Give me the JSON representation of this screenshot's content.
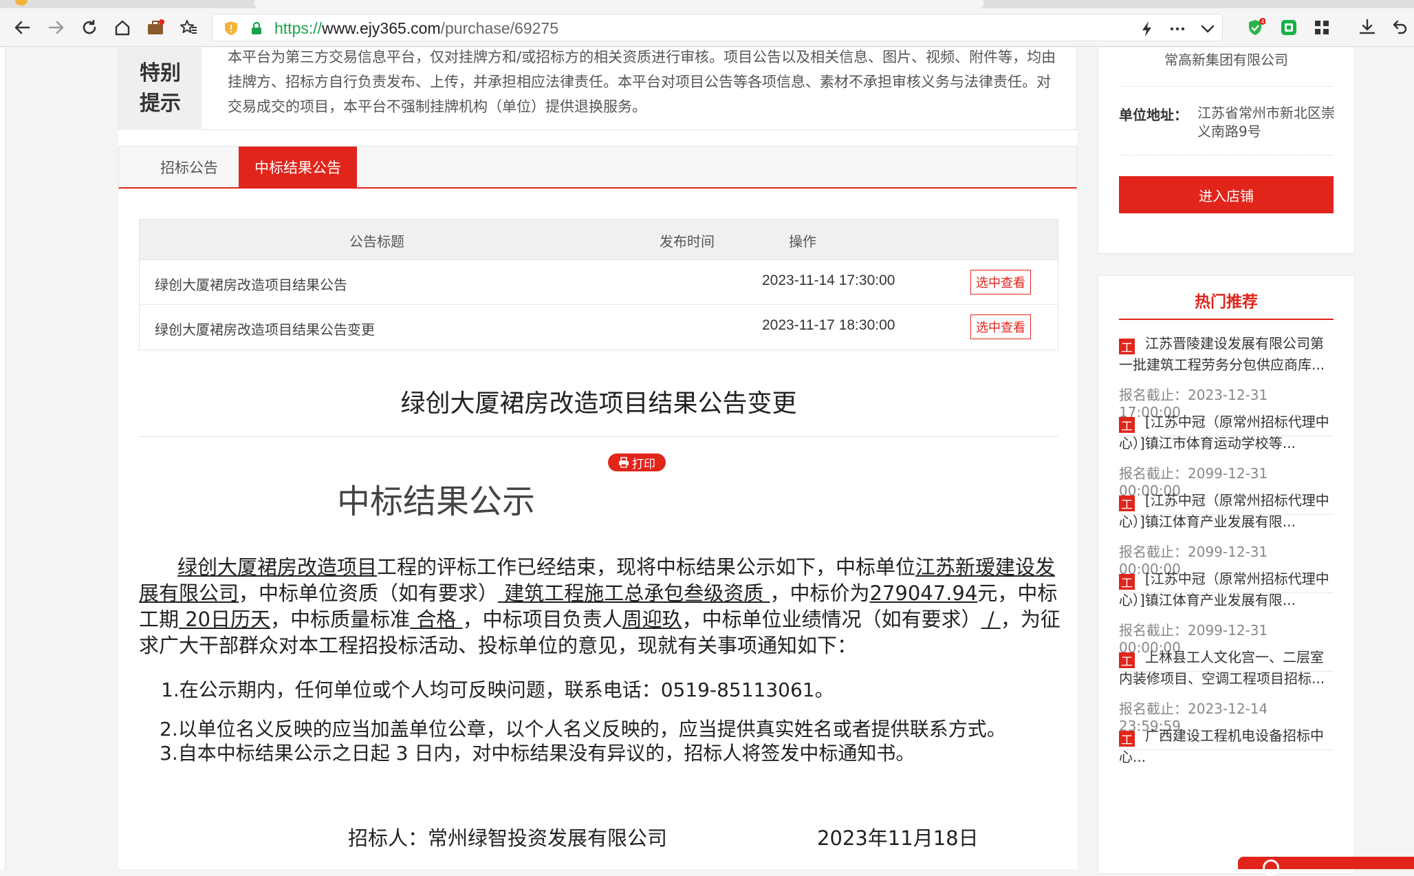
{
  "browser": {
    "url_protocol": "https://",
    "url_host": "www.ejy365.com",
    "url_path": "/purchase/69275",
    "badge_count": "4"
  },
  "notice": {
    "label_line1": "特别",
    "label_line2": "提示",
    "text": "本平台为第三方交易信息平台，仅对挂牌方和/或招标方的相关资质进行审核。项目公告以及相关信息、图片、视频、附件等，均由挂牌方、招标方自行负责发布、上传，并承担相应法律责任。本平台对项目公告等各项信息、素材不承担审核义务与法律责任。对交易成交的项目，本平台不强制挂牌机构（单位）提供退换服务。"
  },
  "tabs": [
    {
      "label": "招标公告",
      "active": false
    },
    {
      "label": "中标结果公告",
      "active": true
    }
  ],
  "table": {
    "headers": [
      "公告标题",
      "发布时间",
      "操作"
    ],
    "rows": [
      {
        "title": "绿创大厦裙房改造项目结果公告",
        "time": "2023-11-14 17:30:00",
        "action": "选中查看"
      },
      {
        "title": "绿创大厦裙房改造项目结果公告变更",
        "time": "2023-11-17 18:30:00",
        "action": "选中查看"
      }
    ]
  },
  "article": {
    "title": "绿创大厦裙房改造项目结果公告变更",
    "print_label": "打印",
    "doc_heading": "中标结果公示",
    "para": {
      "project": "绿创大厦裙房改造项目",
      "t1": "工程的评标工作已经结束，现将中标结果公示如下，中标单位",
      "winner": "江苏新瑷建设发展有限公司",
      "t2": "，中标单位资质（如有要求）",
      "qualification": " 建筑工程施工总承包叁级资质 ",
      "t3": "，中标价为",
      "price": "279047.94",
      "t4": "元，中标工期",
      "period": " 20日历天",
      "t5": "，中标质量标准",
      "quality": " 合格 ",
      "t6": "，中标项目负责人",
      "manager": "周迎玖",
      "t7": "，中标单位业绩情况（如有要求）",
      "record": " / ",
      "t8": "，为征求广大干部群众对本工程招投标活动、投标单位的意见，现就有关事项通知如下："
    },
    "items": [
      "1.在公示期内，任何单位或个人均可反映问题，联系电话：0519-85113061。",
      "2.以单位名义反映的应当加盖单位公章，以个人名义反映的，应当提供真实姓名或者提供联系方式。",
      "3.自本中标结果公示之日起 3 日内，对中标结果没有异议的，招标人将签发中标通知书。"
    ],
    "signer": "招标人：常州绿智投资发展有限公司",
    "sign_date": "2023年11月18日"
  },
  "sidebar": {
    "company": "常高新集团有限公司",
    "address_label": "单位地址：",
    "address_value": "江苏省常州市新北区崇义南路9号",
    "shop_button": "进入店铺",
    "hot_title": "热门推荐",
    "recommendations": [
      {
        "icon": "工",
        "title": "江苏晋陵建设发展有限公司第一批建筑工程劳务分包供应商库...",
        "deadline": "报名截止：2023-12-31 17:00:00"
      },
      {
        "icon": "工",
        "title": "[江苏中冠（原常州招标代理中心）]镇江市体育运动学校等...",
        "deadline": "报名截止：2099-12-31 00:00:00"
      },
      {
        "icon": "工",
        "title": "[江苏中冠（原常州招标代理中心）]镇江体育产业发展有限...",
        "deadline": "报名截止：2099-12-31 00:00:00"
      },
      {
        "icon": "工",
        "title": "[江苏中冠（原常州招标代理中心）]镇江体育产业发展有限...",
        "deadline": "报名截止：2099-12-31 00:00:00"
      },
      {
        "icon": "工",
        "title": "上林县工人文化宫一、二层室内装修项目、空调工程项目招标...",
        "deadline": "报名截止：2023-12-14 23:59:59"
      },
      {
        "icon": "工",
        "title": "广西建设工程机电设备招标中心...",
        "deadline": ""
      }
    ]
  },
  "colors": {
    "accent": "#e1251b",
    "link_green": "#1aa34a"
  }
}
